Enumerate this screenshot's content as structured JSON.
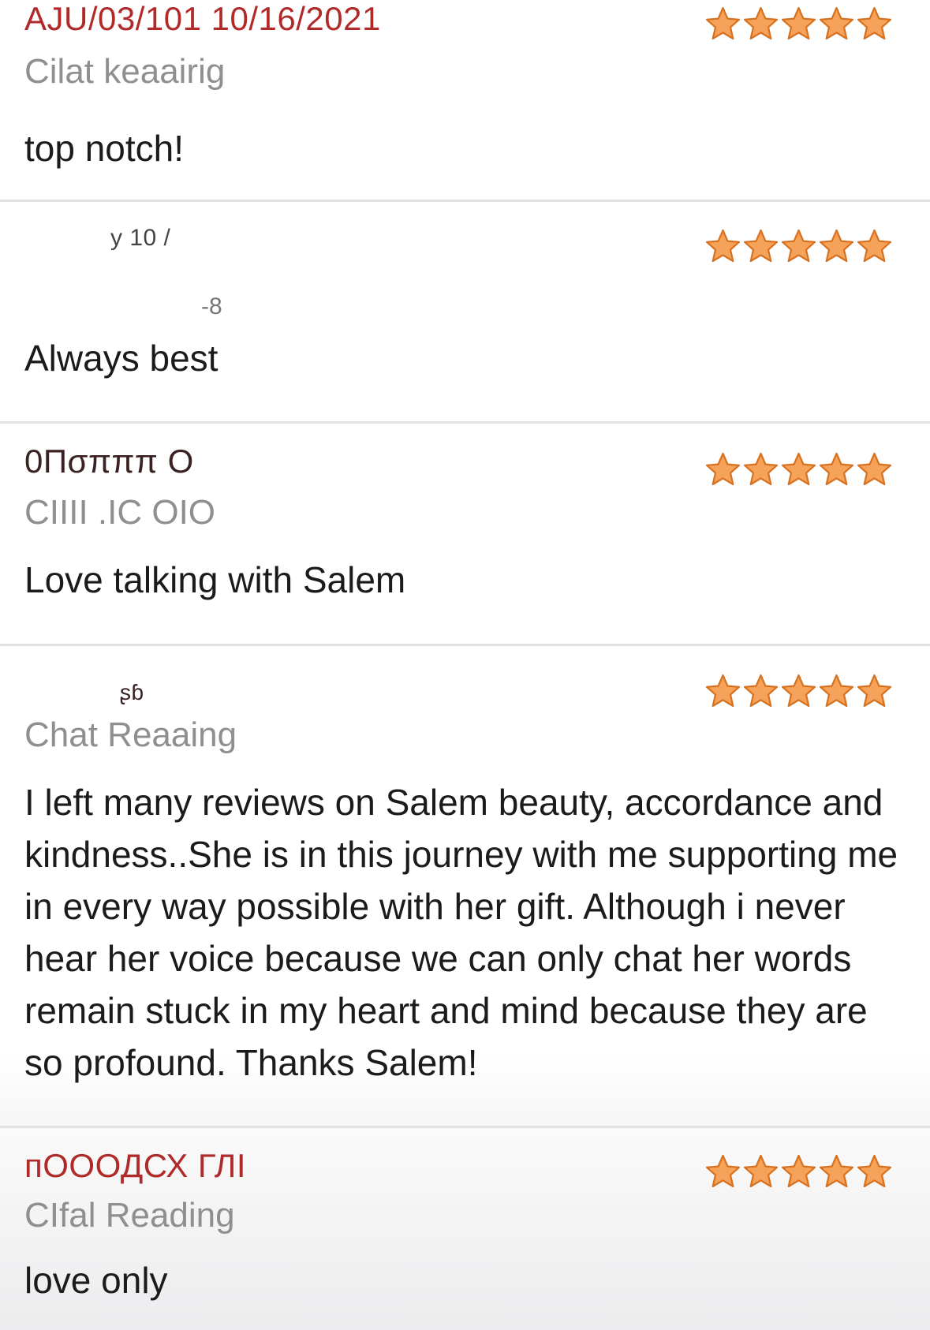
{
  "reviews": [
    {
      "date": "AJU/03/101 10/16/2021",
      "reading_type": "Cilat keaairig",
      "comment": "top notch!",
      "rating": 5
    },
    {
      "date": "у 10 /",
      "reading_type": "-8",
      "comment": "Always best",
      "rating": 5
    },
    {
      "date": "0Пσπππ О",
      "reading_type": "CIIII .IC OIO",
      "comment": "Love talking with Salem",
      "rating": 5
    },
    {
      "date": "ʂɓ",
      "reading_type": "Chat Reaaing",
      "comment": "I left many reviews on Salem beauty, accordance and kindness..She is in this journey with me supporting me in every way possible with her gift. Although i never hear her voice because we can only chat her words remain stuck in my heart and mind because they are so profound. Thanks Salem!",
      "rating": 5
    },
    {
      "date": "пОООДСХ ГЛІ",
      "reading_type": "CIfal Reading",
      "comment": "love only",
      "rating": 5
    }
  ],
  "colors": {
    "star_fill": "#f5a35a",
    "star_stroke": "#d8701e",
    "date_red": "#b12a2a",
    "reading_gray": "#8f8f8f",
    "divider": "#e0e3e6"
  },
  "icons": {
    "star": "star-icon"
  }
}
